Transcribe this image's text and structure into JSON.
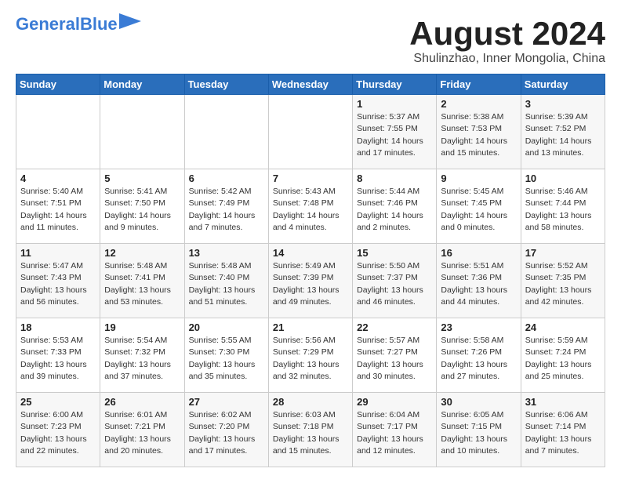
{
  "header": {
    "logo_general": "General",
    "logo_blue": "Blue",
    "month_title": "August 2024",
    "subtitle": "Shulinzhao, Inner Mongolia, China"
  },
  "days_of_week": [
    "Sunday",
    "Monday",
    "Tuesday",
    "Wednesday",
    "Thursday",
    "Friday",
    "Saturday"
  ],
  "weeks": [
    [
      {
        "day": "",
        "info": ""
      },
      {
        "day": "",
        "info": ""
      },
      {
        "day": "",
        "info": ""
      },
      {
        "day": "",
        "info": ""
      },
      {
        "day": "1",
        "info": "Sunrise: 5:37 AM\nSunset: 7:55 PM\nDaylight: 14 hours\nand 17 minutes."
      },
      {
        "day": "2",
        "info": "Sunrise: 5:38 AM\nSunset: 7:53 PM\nDaylight: 14 hours\nand 15 minutes."
      },
      {
        "day": "3",
        "info": "Sunrise: 5:39 AM\nSunset: 7:52 PM\nDaylight: 14 hours\nand 13 minutes."
      }
    ],
    [
      {
        "day": "4",
        "info": "Sunrise: 5:40 AM\nSunset: 7:51 PM\nDaylight: 14 hours\nand 11 minutes."
      },
      {
        "day": "5",
        "info": "Sunrise: 5:41 AM\nSunset: 7:50 PM\nDaylight: 14 hours\nand 9 minutes."
      },
      {
        "day": "6",
        "info": "Sunrise: 5:42 AM\nSunset: 7:49 PM\nDaylight: 14 hours\nand 7 minutes."
      },
      {
        "day": "7",
        "info": "Sunrise: 5:43 AM\nSunset: 7:48 PM\nDaylight: 14 hours\nand 4 minutes."
      },
      {
        "day": "8",
        "info": "Sunrise: 5:44 AM\nSunset: 7:46 PM\nDaylight: 14 hours\nand 2 minutes."
      },
      {
        "day": "9",
        "info": "Sunrise: 5:45 AM\nSunset: 7:45 PM\nDaylight: 14 hours\nand 0 minutes."
      },
      {
        "day": "10",
        "info": "Sunrise: 5:46 AM\nSunset: 7:44 PM\nDaylight: 13 hours\nand 58 minutes."
      }
    ],
    [
      {
        "day": "11",
        "info": "Sunrise: 5:47 AM\nSunset: 7:43 PM\nDaylight: 13 hours\nand 56 minutes."
      },
      {
        "day": "12",
        "info": "Sunrise: 5:48 AM\nSunset: 7:41 PM\nDaylight: 13 hours\nand 53 minutes."
      },
      {
        "day": "13",
        "info": "Sunrise: 5:48 AM\nSunset: 7:40 PM\nDaylight: 13 hours\nand 51 minutes."
      },
      {
        "day": "14",
        "info": "Sunrise: 5:49 AM\nSunset: 7:39 PM\nDaylight: 13 hours\nand 49 minutes."
      },
      {
        "day": "15",
        "info": "Sunrise: 5:50 AM\nSunset: 7:37 PM\nDaylight: 13 hours\nand 46 minutes."
      },
      {
        "day": "16",
        "info": "Sunrise: 5:51 AM\nSunset: 7:36 PM\nDaylight: 13 hours\nand 44 minutes."
      },
      {
        "day": "17",
        "info": "Sunrise: 5:52 AM\nSunset: 7:35 PM\nDaylight: 13 hours\nand 42 minutes."
      }
    ],
    [
      {
        "day": "18",
        "info": "Sunrise: 5:53 AM\nSunset: 7:33 PM\nDaylight: 13 hours\nand 39 minutes."
      },
      {
        "day": "19",
        "info": "Sunrise: 5:54 AM\nSunset: 7:32 PM\nDaylight: 13 hours\nand 37 minutes."
      },
      {
        "day": "20",
        "info": "Sunrise: 5:55 AM\nSunset: 7:30 PM\nDaylight: 13 hours\nand 35 minutes."
      },
      {
        "day": "21",
        "info": "Sunrise: 5:56 AM\nSunset: 7:29 PM\nDaylight: 13 hours\nand 32 minutes."
      },
      {
        "day": "22",
        "info": "Sunrise: 5:57 AM\nSunset: 7:27 PM\nDaylight: 13 hours\nand 30 minutes."
      },
      {
        "day": "23",
        "info": "Sunrise: 5:58 AM\nSunset: 7:26 PM\nDaylight: 13 hours\nand 27 minutes."
      },
      {
        "day": "24",
        "info": "Sunrise: 5:59 AM\nSunset: 7:24 PM\nDaylight: 13 hours\nand 25 minutes."
      }
    ],
    [
      {
        "day": "25",
        "info": "Sunrise: 6:00 AM\nSunset: 7:23 PM\nDaylight: 13 hours\nand 22 minutes."
      },
      {
        "day": "26",
        "info": "Sunrise: 6:01 AM\nSunset: 7:21 PM\nDaylight: 13 hours\nand 20 minutes."
      },
      {
        "day": "27",
        "info": "Sunrise: 6:02 AM\nSunset: 7:20 PM\nDaylight: 13 hours\nand 17 minutes."
      },
      {
        "day": "28",
        "info": "Sunrise: 6:03 AM\nSunset: 7:18 PM\nDaylight: 13 hours\nand 15 minutes."
      },
      {
        "day": "29",
        "info": "Sunrise: 6:04 AM\nSunset: 7:17 PM\nDaylight: 13 hours\nand 12 minutes."
      },
      {
        "day": "30",
        "info": "Sunrise: 6:05 AM\nSunset: 7:15 PM\nDaylight: 13 hours\nand 10 minutes."
      },
      {
        "day": "31",
        "info": "Sunrise: 6:06 AM\nSunset: 7:14 PM\nDaylight: 13 hours\nand 7 minutes."
      }
    ]
  ]
}
